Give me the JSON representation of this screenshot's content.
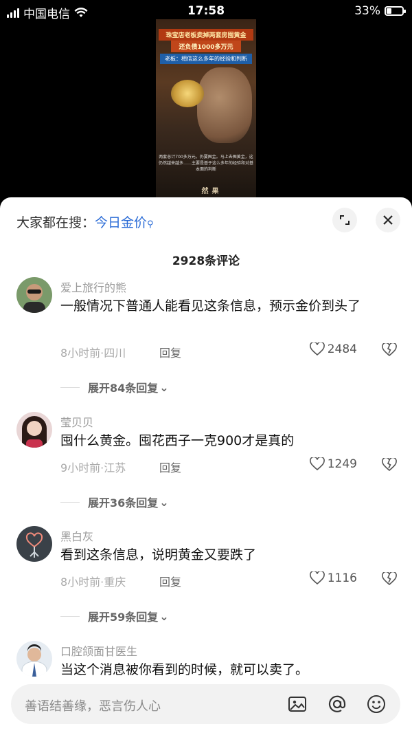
{
  "status": {
    "carrier": "中国电信",
    "time": "17:58",
    "battery_text": "33%",
    "battery_level": 0.33
  },
  "video": {
    "caption_line1": "珠宝店老板卖掉两套房囤黄金",
    "caption_line2": "还负债1000多万元",
    "caption_line3": "老板：相信这么多年的经验和判断",
    "subtitle": "两套总计700多万元，仍要囤金。马上去囤黄金，这仍然越来越多……主要是基于这么多年的经验和对基本面的判断",
    "logo": "果然"
  },
  "sheet": {
    "search_prefix": "大家都在搜：",
    "search_keyword": "今日金价",
    "comment_count": "2928条评论"
  },
  "comments": [
    {
      "user": "爱上旅行的熊",
      "text": "一般情况下普通人能看见这条信息，预示金价到头了",
      "meta": "8小时前·四川",
      "reply": "回复",
      "likes": "2484",
      "expand": "展开84条回复"
    },
    {
      "user": "莹贝贝",
      "text": "囤什么黄金。囤花西子一克900才是真的",
      "meta": "9小时前·江苏",
      "reply": "回复",
      "likes": "1249",
      "expand": "展开36条回复"
    },
    {
      "user": "黑白灰",
      "text": "看到这条信息，说明黄金又要跌了",
      "meta": "8小时前·重庆",
      "reply": "回复",
      "likes": "1116",
      "expand": "展开59条回复"
    },
    {
      "user": "口腔颌面甘医生",
      "text": "当这个消息被你看到的时候，就可以卖了。"
    }
  ],
  "input": {
    "placeholder": "善语结善缘，恶言伤人心"
  },
  "icons": {
    "expand": "expand-icon",
    "close": "close-icon",
    "like": "heart-icon",
    "dislike": "broken-heart-icon",
    "image": "image-icon",
    "mention": "at-icon",
    "emoji": "emoji-icon"
  },
  "colors": {
    "keyword_blue": "#2a6bd6"
  }
}
